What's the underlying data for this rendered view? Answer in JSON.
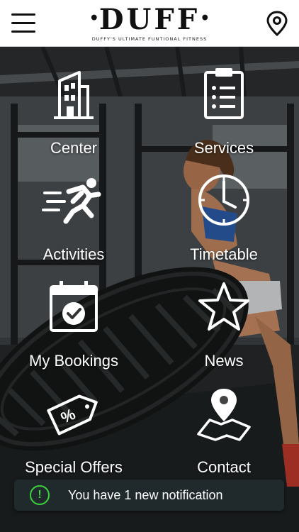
{
  "header": {
    "menu_icon": "hamburger-menu-icon",
    "logo_text": "DUFF",
    "logo_dot": "•",
    "logo_tagline": "Duffy's Ultimate Funtional Fitness",
    "location_icon": "map-pin-icon"
  },
  "menu": {
    "center": {
      "label": "Center",
      "icon": "building-icon"
    },
    "services": {
      "label": "Services",
      "icon": "clipboard-list-icon"
    },
    "activities": {
      "label": "Activities",
      "icon": "running-man-icon"
    },
    "timetable": {
      "label": "Timetable",
      "icon": "clock-icon"
    },
    "bookings": {
      "label": "My Bookings",
      "icon": "calendar-check-icon"
    },
    "news": {
      "label": "News",
      "icon": "star-icon"
    },
    "offers": {
      "label": "Special Offers",
      "icon": "percent-tag-icon"
    },
    "contact": {
      "label": "Contact",
      "icon": "map-location-icon"
    }
  },
  "notification": {
    "icon": "exclamation-circle-icon",
    "symbol": "!",
    "text": "You have 1 new notification",
    "accent": "#3cd33c"
  }
}
